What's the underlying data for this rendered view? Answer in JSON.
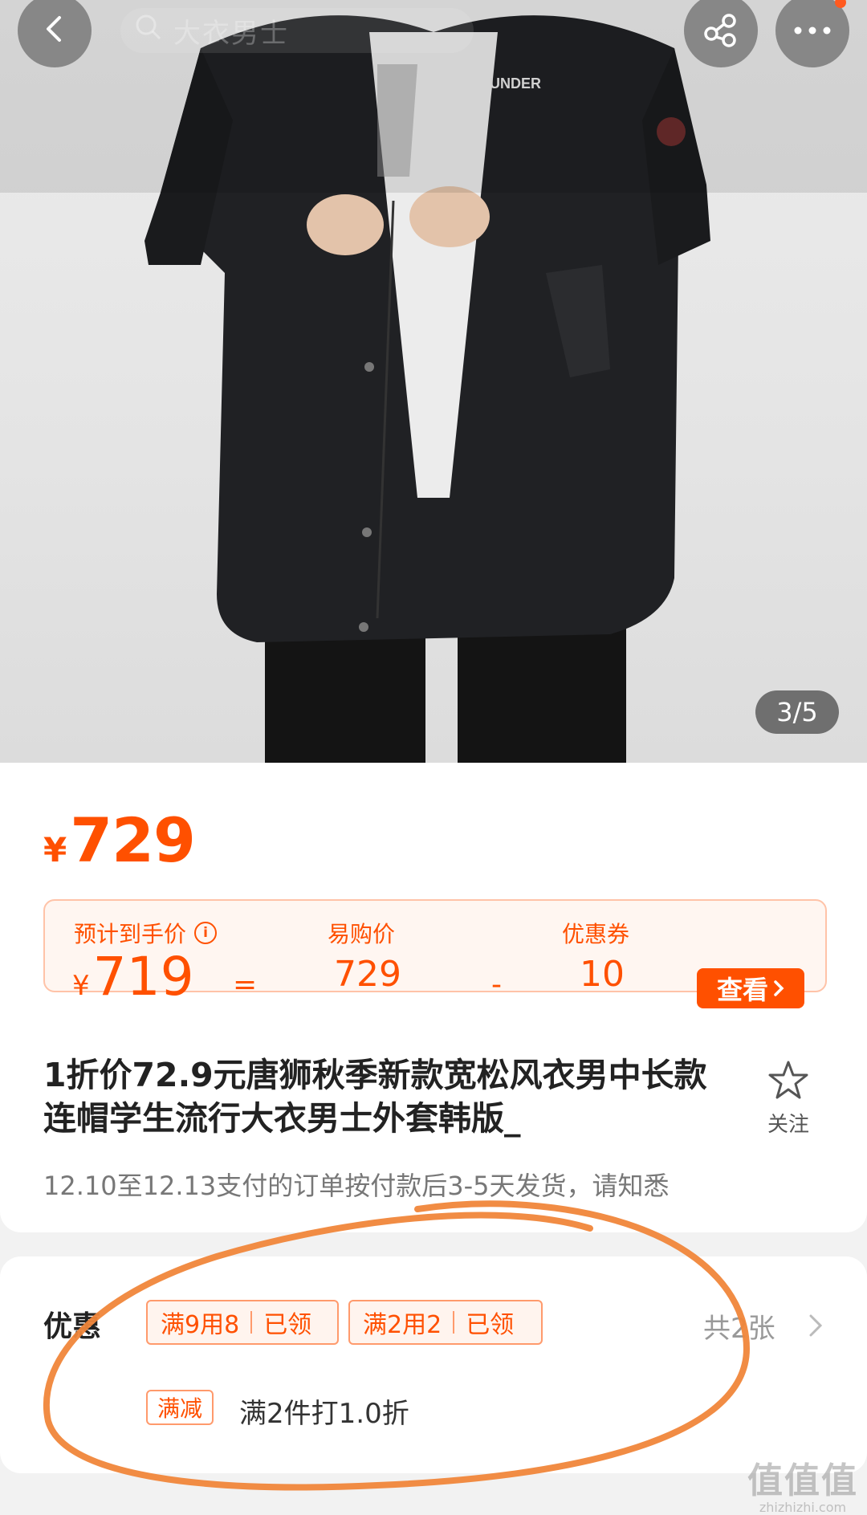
{
  "header": {
    "search_placeholder": "大衣男士",
    "image_counter": "3/5",
    "jacket_brand_text": "UNDER"
  },
  "product": {
    "currency": "¥",
    "price": "729",
    "calc": {
      "expected_label": "预计到手价",
      "info_glyph": "i",
      "expected_currency": "¥",
      "expected_value": "719",
      "eq": "=",
      "yigou_label": "易购价",
      "yigou_value": "729",
      "minus": "-",
      "coupon_label": "优惠券",
      "coupon_value": "10",
      "view_button": "查看"
    },
    "title": "1折价72.9元唐狮秋季新款宽松风衣男中长款连帽学生流行大衣男士外套韩版_",
    "follow_label": "关注",
    "shipping_note": "12.10至12.13支付的订单按付款后3-5天发货，请知悉"
  },
  "promo": {
    "title": "优惠",
    "coupons": [
      {
        "text": "满9用8",
        "status": "已领"
      },
      {
        "text": "满2用2",
        "status": "已领"
      }
    ],
    "total": "共2张",
    "discount_tag": "满减",
    "discount_text": "满2件打1.0折"
  },
  "watermark": {
    "big": "值值值",
    "small": "zhizhizhi.com"
  },
  "colors": {
    "accent": "#ff5000",
    "annotation": "#f0863a"
  }
}
